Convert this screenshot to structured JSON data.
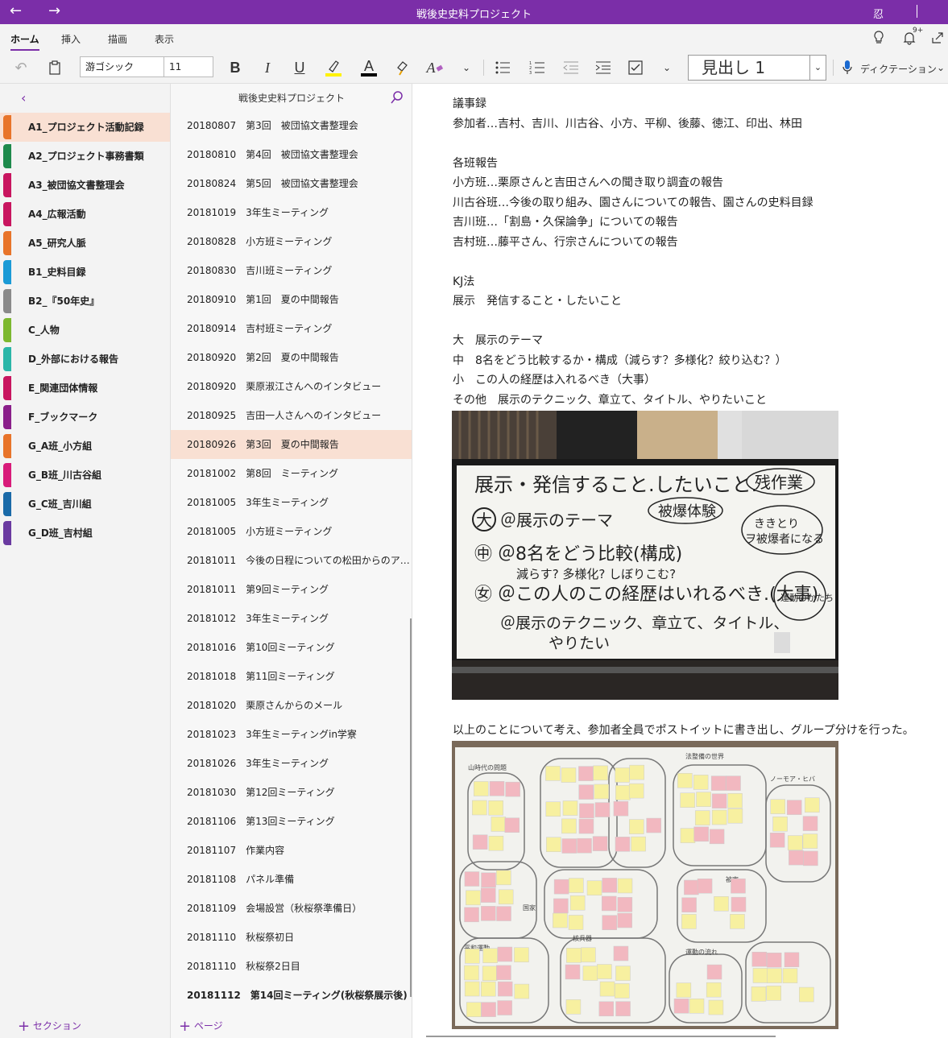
{
  "app": {
    "title": "戦後史史料プロジェクト",
    "user": "忍",
    "back_icon": "arrow-left-icon",
    "forward_icon": "arrow-right-icon"
  },
  "ribbon": {
    "tabs": [
      {
        "label": "ホーム",
        "active": true
      },
      {
        "label": "挿入"
      },
      {
        "label": "描画"
      },
      {
        "label": "表示"
      }
    ],
    "notification_badge": "9+"
  },
  "toolbar": {
    "font_name": "游ゴシック",
    "font_size": "11",
    "bold": "B",
    "italic": "I",
    "underline": "U",
    "font_color_glyph": "A",
    "styles_glyph": "A",
    "heading_style": "見出し 1",
    "dictation": "ディクテーション",
    "highlight_color": "#fff200",
    "font_color": "#000000"
  },
  "notebook": {
    "title": "戦後史史料プロジェクト",
    "sections": [
      {
        "label": "A1_プロジェクト活動記録",
        "color": "#e8742a",
        "active": true
      },
      {
        "label": "A2_プロジェクト事務書類",
        "color": "#1e8a4c"
      },
      {
        "label": "A3_被団協文書整理会",
        "color": "#c8155f"
      },
      {
        "label": "A4_広報活動",
        "color": "#c8155f"
      },
      {
        "label": "A5_研究人脈",
        "color": "#e8742a"
      },
      {
        "label": "B1_史料目録",
        "color": "#1a9ad6"
      },
      {
        "label": "B2_『50年史』",
        "color": "#8a8a8a"
      },
      {
        "label": "C_人物",
        "color": "#7cb82f"
      },
      {
        "label": "D_外部における報告",
        "color": "#2bb6a8"
      },
      {
        "label": "E_関連団体情報",
        "color": "#c8155f"
      },
      {
        "label": "F_ブックマーク",
        "color": "#8a1f8a"
      },
      {
        "label": "G_A班_小方組",
        "color": "#e8742a"
      },
      {
        "label": "G_B班_川古谷組",
        "color": "#d81b7a"
      },
      {
        "label": "G_C班_吉川組",
        "color": "#1a6aa8"
      },
      {
        "label": "G_D班_吉村組",
        "color": "#6a3aa0"
      }
    ],
    "add_section": "セクション",
    "add_page": "ページ"
  },
  "pages": [
    {
      "label": "20180807　第3回　被団協文書整理会"
    },
    {
      "label": "20180810　第4回　被団協文書整理会"
    },
    {
      "label": "20180824　第5回　被団協文書整理会"
    },
    {
      "label": "20181019　3年生ミーティング"
    },
    {
      "label": "20180828　小方班ミーティング"
    },
    {
      "label": "20180830　吉川班ミーティング"
    },
    {
      "label": "20180910　第1回　夏の中間報告"
    },
    {
      "label": "20180914　吉村班ミーティング"
    },
    {
      "label": "20180920　第2回　夏の中間報告"
    },
    {
      "label": "20180920　栗原淑江さんへのインタビュー"
    },
    {
      "label": "20180925　吉田一人さんへのインタビュー"
    },
    {
      "label": "20180926　第3回　夏の中間報告",
      "active": true
    },
    {
      "label": "20181002　第8回　ミーティング"
    },
    {
      "label": "20181005　3年生ミーティング"
    },
    {
      "label": "20181005　小方班ミーティング"
    },
    {
      "label": "20181011　今後の日程についての松田からのア…"
    },
    {
      "label": "20181011　第9回ミーティング"
    },
    {
      "label": "20181012　3年生ミーティング"
    },
    {
      "label": "20181016　第10回ミーティング"
    },
    {
      "label": "20181018　第11回ミーティング"
    },
    {
      "label": "20181020　栗原さんからのメール"
    },
    {
      "label": "20181023　3年生ミーティングin学寮"
    },
    {
      "label": "20181026　3年生ミーティング"
    },
    {
      "label": "20181030　第12回ミーティング"
    },
    {
      "label": "20181106　第13回ミーティング"
    },
    {
      "label": "20181107　作業内容"
    },
    {
      "label": "20181108　パネル準備"
    },
    {
      "label": "20181109　会場設営（秋桜祭準備日）"
    },
    {
      "label": "20181110　秋桜祭初日"
    },
    {
      "label": "20181110　秋桜祭2日目"
    },
    {
      "label": "20181112　第14回ミーティング(秋桜祭展示後)",
      "bold": true
    }
  ],
  "note": {
    "lines_top": [
      "議事録",
      "参加者…吉村、吉川、川古谷、小方、平柳、後藤、徳江、印出、林田",
      "",
      "各班報告",
      "小方班…栗原さんと吉田さんへの聞き取り調査の報告",
      "川古谷班…今後の取り組み、園さんについての報告、園さんの史料目録",
      "吉川班…「割島・久保論争」についての報告",
      "吉村班…藤平さん、行宗さんについての報告",
      "",
      "KJ法",
      "展示　発信すること・したいこと",
      "",
      "大　展示のテーマ",
      "中　8名をどう比較するか・構成（減らす？多様化？絞り込む？）",
      "小　この人の経歴は入れるべき（大事）",
      "その他　展示のテクニック、章立て、タイトル、やりたいこと"
    ],
    "line_after_photo": "以上のことについて考え、参加者全員でポストイットに書き出し、グループ分けを行った。",
    "whiteboard_photo": {
      "lines": [
        "展示・発信すること.したいこと.",
        "㊥ ＠8名をどう比較(構成)",
        "減らす? 多様化? しぼりこむ?",
        "㊛ ＠この人のこの経歴はいれるべき.(大事)",
        "＠展示のテクニック、章立て、タイトル、",
        "やりたい"
      ],
      "big_circle": "大",
      "theme": "＠展示のテーマ",
      "bubble_work": "残作業",
      "bubble_experience": "被爆体験",
      "bubble_kiki": "ききとり",
      "bubble_hibakusha": "ヲ被爆者になる",
      "bubble_pattern": "運動のかたち"
    },
    "postit_photo": {
      "labels": [
        "山時代の問題",
        "法整備の世界",
        "ノーモア・ヒバ",
        "国家",
        "被害",
        "平和運動",
        "核兵器",
        "運動の流れ"
      ]
    }
  }
}
